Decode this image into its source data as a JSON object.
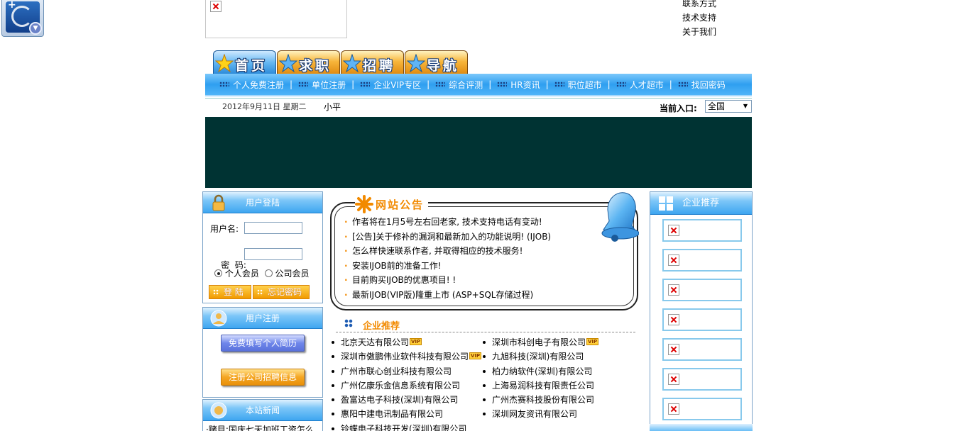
{
  "top_links": [
    "联系方式",
    "技术支持",
    "关于我们"
  ],
  "main_tabs": [
    "首页",
    "求职",
    "招聘",
    "导航"
  ],
  "nav_links": [
    "个人免费注册",
    "单位注册",
    "企业VIP专区",
    "综合评测",
    "HR资讯",
    "职位超市",
    "人才超市",
    "找回密码"
  ],
  "date_text": "2012年9月11日  星期二",
  "user_text": "小平",
  "entry": {
    "label": "当前入口:",
    "value": "全国"
  },
  "login": {
    "title": "用户登陆",
    "username_label": "用户名:",
    "password_label": "密  码:",
    "radio_person": "个人会员",
    "radio_company": "公司会员",
    "login_button": "登 陆",
    "forgot_button": "忘记密码"
  },
  "register": {
    "title": "用户注册",
    "person_button": "免费填写个人简历",
    "company_button": "注册公司招聘信息"
  },
  "news": {
    "title": "本站新闻",
    "first_item": "·赌目:国庆七天加班工资怎么"
  },
  "announcement": {
    "title": "网站公告",
    "items": [
      "作者将在1月5号左右回老家, 技术支持电话有变动!",
      "[公告]关于修补的漏洞和最新加入的功能说明! (IJOB)",
      "怎么样快速联系作者, 并取得相应的技术服务!",
      "安装IJOB前的准备工作!",
      "目前购买IJOB的优惠项目! !",
      "最新IJOB(VIP版)隆重上市 (ASP+SQL存储过程)"
    ]
  },
  "enterprise": {
    "title": "企业推荐",
    "vip_label": "VIP",
    "left": [
      {
        "name": "北京天达有限公司",
        "vip": true
      },
      {
        "name": "深圳市傲鹏伟业软件科技有限公司",
        "vip": true
      },
      {
        "name": "广州市联心创业科技有限公司",
        "vip": false
      },
      {
        "name": "广州亿康乐金信息系统有限公司",
        "vip": false
      },
      {
        "name": "盈富达电子科技(深圳)有限公司",
        "vip": false
      },
      {
        "name": "惠阳中建电讯制品有限公司",
        "vip": false
      },
      {
        "name": "铃蝶电子科技开发(深圳)有限公司",
        "vip": false
      }
    ],
    "right": [
      {
        "name": "深圳市科创电子有限公司",
        "vip": true
      },
      {
        "name": "九旭科技(深圳)有限公司",
        "vip": false
      },
      {
        "name": "柏力纳软件(深圳)有限公司",
        "vip": false
      },
      {
        "name": "上海易润科技有限责任公司",
        "vip": false
      },
      {
        "name": "广州杰赛科技股份有限公司",
        "vip": false
      },
      {
        "name": "深圳网友资讯有限公司",
        "vip": false
      }
    ]
  },
  "right_panel": {
    "title": "企业推荐",
    "logo_count": 7
  }
}
